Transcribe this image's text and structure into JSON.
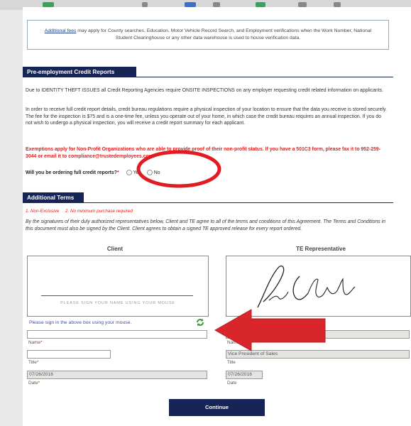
{
  "notice": {
    "link": "Additional fees",
    "text": " may apply for County searches, Education, Motor Vehicle Record Search, and Employment verifications when the Work Number, National Student Clearinghouse or any other data warehouse is used to house verification data."
  },
  "credit": {
    "heading": "Pre-employment Credit Reports",
    "p1": "Due to IDENTITY THEFT ISSUES all Credit Reporting Agencies require ONSITE INSPECTIONS on any employer requesting credit related information on applicants.",
    "p2": "In order to receive full credit report details, credit bureau regulations require a physical inspection of your location to ensure that the data you receive is stored securely. The fee for the inspection is $75 and is a one-time fee, unless you operate out of your home, in which case the credit bureau requires an annual inspection. If you do not wish to undergo a physical inspection, you will receive a credit report summary for each applicant.",
    "exemption": "Exemptions apply for Non-Profit Organizations who are able to provide proof of their non-profit status. If you have a 501C3 form, please fax it to 952-259-3044 or email it to compliance@trustedemployees.com.",
    "question": "Will you be ordering full credit reports?",
    "question_star": "*",
    "opt_yes": "Yes",
    "opt_no": "No"
  },
  "terms": {
    "heading": "Additional Terms",
    "bullets": "1. Non-Exclusive     2. No minimum purchase required",
    "para": "By the signatures of their duly authorized representatives below, Client and TE agree to all of the terms and conditions of this Agreement. The Terms and Conditions in this document must also be signed by the Client. Client agrees to obtain a signed TE approved release for every report ordered.",
    "client_heading": "Client",
    "te_heading": "TE Representative",
    "sign_placeholder": "PLEASE SIGN YOUR NAME USING YOUR MOUSE",
    "sign_hint": "Please sign in the above box using your mouse.",
    "te_signature": "Scott Chidlaw",
    "name_label": "Name",
    "title_label": "Title",
    "date_label": "Date",
    "star": "*",
    "client_name": "",
    "client_title": "",
    "client_date": "07/26/2016",
    "te_name": "",
    "te_title": "Vice President of Sales",
    "te_date": "07/26/2016"
  },
  "continue_label": "Continue",
  "colors": {
    "navy": "#162456",
    "red_text": "#e0201f",
    "annotation_red": "#e11b22",
    "refresh_green": "#3c9a3c"
  }
}
